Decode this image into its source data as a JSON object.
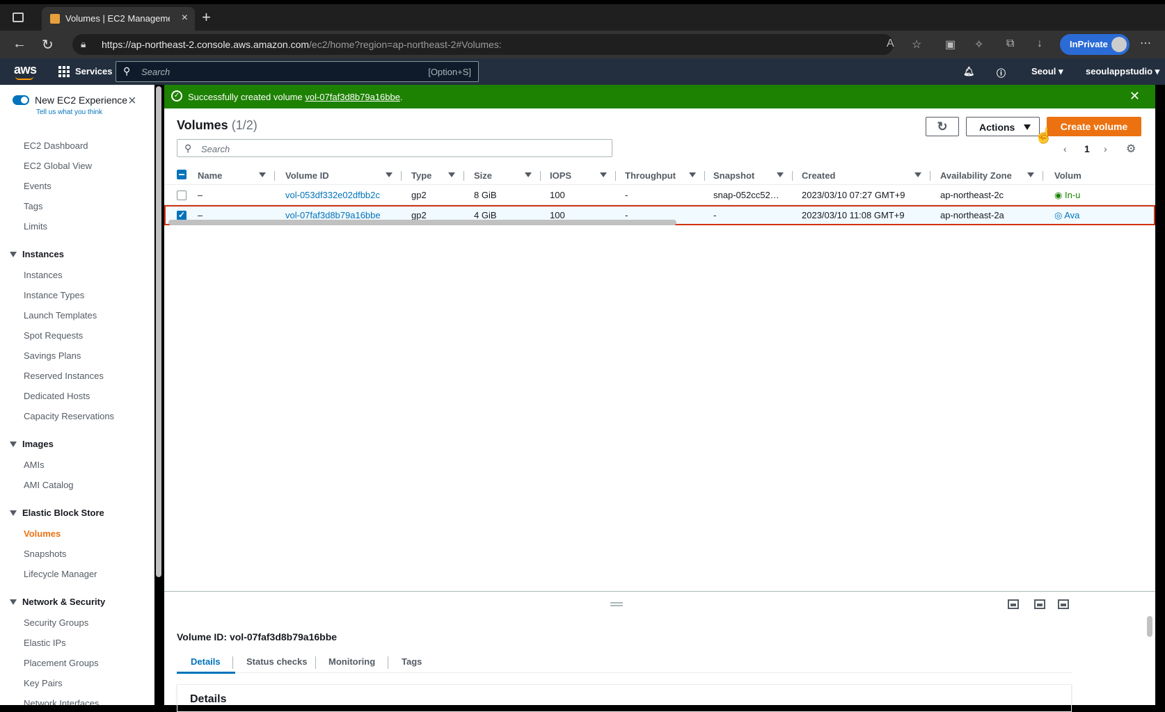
{
  "browser": {
    "tab_title": "Volumes | EC2 Management Console",
    "url_host": "https://ap-northeast-2.console.aws.amazon.com",
    "url_rest": "/ec2/home?region=ap-northeast-2#Volumes:",
    "inprivate_label": "InPrivate"
  },
  "aws_nav": {
    "logo": "aws",
    "services": "Services",
    "search_placeholder": "Search",
    "search_shortcut": "[Option+S]",
    "region": "Seoul ▾",
    "account": "seoulappstudio ▾"
  },
  "sidebar": {
    "experience_title": "New EC2 Experience",
    "experience_sub": "Tell us what you think",
    "top_items": [
      "EC2 Dashboard",
      "EC2 Global View",
      "Events",
      "Tags",
      "Limits"
    ],
    "instances_title": "Instances",
    "instances_items": [
      "Instances",
      "Instance Types",
      "Launch Templates",
      "Spot Requests",
      "Savings Plans",
      "Reserved Instances",
      "Dedicated Hosts",
      "Capacity Reservations"
    ],
    "images_title": "Images",
    "images_items": [
      "AMIs",
      "AMI Catalog"
    ],
    "ebs_title": "Elastic Block Store",
    "ebs_items": [
      "Volumes",
      "Snapshots",
      "Lifecycle Manager"
    ],
    "network_title": "Network & Security",
    "network_items": [
      "Security Groups",
      "Elastic IPs",
      "Placement Groups",
      "Key Pairs",
      "Network Interfaces"
    ]
  },
  "flash": {
    "prefix": "Successfully created volume ",
    "link": "vol-07faf3d8b79a16bbe",
    "suffix": "."
  },
  "main": {
    "title": "Volumes",
    "count": "(1/2)",
    "actions_label": "Actions",
    "create_label": "Create volume",
    "search_placeholder": "Search",
    "page_number": "1"
  },
  "table": {
    "headers": [
      "Name",
      "Volume ID",
      "Type",
      "Size",
      "IOPS",
      "Throughput",
      "Snapshot",
      "Created",
      "Availability Zone",
      "Volum"
    ],
    "rows": [
      {
        "name": "–",
        "volume_id": "vol-053df332e02dfbb2c",
        "type": "gp2",
        "size": "8 GiB",
        "iops": "100",
        "throughput": "-",
        "snapshot": "snap-052cc52…",
        "created": "2023/03/10 07:27 GMT+9",
        "az": "ap-northeast-2c",
        "state": "In-u",
        "selected": false
      },
      {
        "name": "–",
        "volume_id": "vol-07faf3d8b79a16bbe",
        "type": "gp2",
        "size": "4 GiB",
        "iops": "100",
        "throughput": "-",
        "snapshot": "-",
        "created": "2023/03/10 11:08 GMT+9",
        "az": "ap-northeast-2a",
        "state": "Ava",
        "selected": true
      }
    ]
  },
  "details": {
    "title": "Volume ID: vol-07faf3d8b79a16bbe",
    "tabs": [
      "Details",
      "Status checks",
      "Monitoring",
      "Tags"
    ],
    "section_title": "Details"
  }
}
